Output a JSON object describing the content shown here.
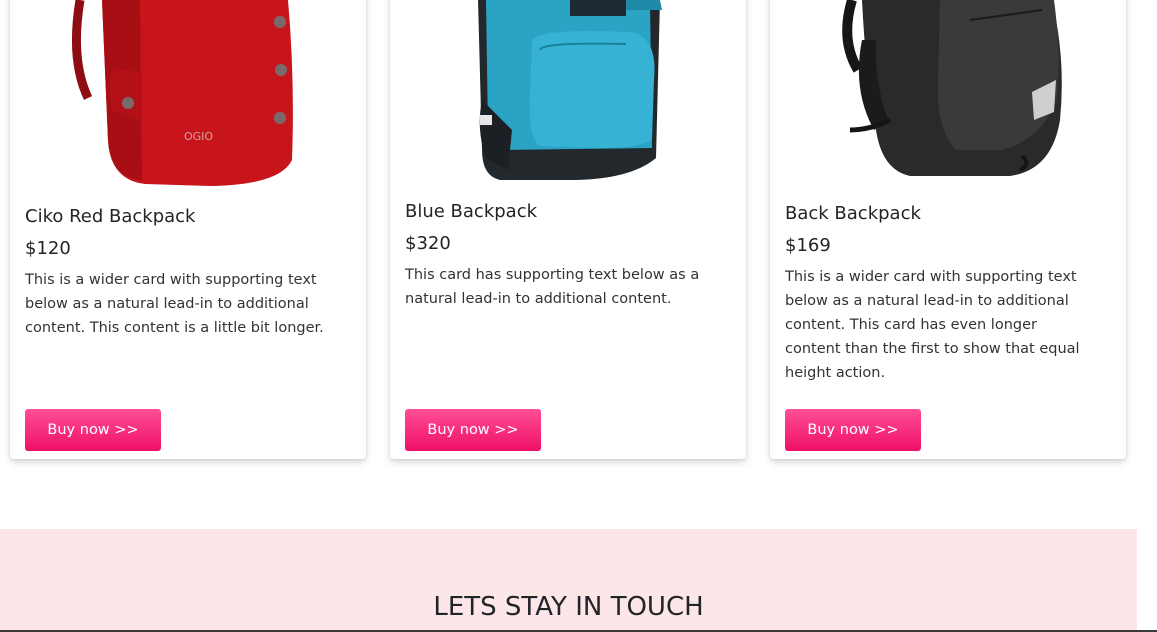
{
  "products": [
    {
      "title": "Ciko Red Backpack",
      "price": "$120",
      "text": "This is a wider card with supporting text below as a natural lead-in to additional content. This content is a little bit longer.",
      "button": "Buy now >>",
      "image_icon": "red-backpack-image",
      "brand_mark": "OGIO"
    },
    {
      "title": "Blue Backpack",
      "price": "$320",
      "text": "This card has supporting text below as a natural lead-in to additional content.",
      "button": "Buy now >>",
      "image_icon": "blue-backpack-image"
    },
    {
      "title": "Back Backpack",
      "price": "$169",
      "text": "This is a wider card with supporting text below as a natural lead-in to additional content. This card has even longer content than the first to show that equal height action.",
      "button": "Buy now >>",
      "image_icon": "black-backpack-image"
    }
  ],
  "contact": {
    "title": "LETS STAY IN TOUCH"
  },
  "colors": {
    "button_top": "#ff4f96",
    "button_bottom": "#ef0f67",
    "contact_background": "#fde6e8",
    "red_product": "#c8141b",
    "blue_product": "#29a3c4",
    "black_product": "#2a2a2a"
  }
}
